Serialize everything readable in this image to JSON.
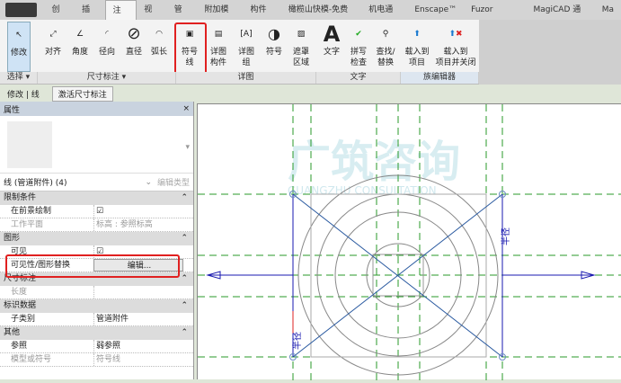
{
  "tabs": [
    "创建",
    "插入",
    "注释",
    "视图",
    "管理",
    "附加模块",
    "构件坞",
    "橄榄山快模-免费版",
    "机电通用",
    "Enscape™",
    "Fuzor Plugin",
    "MagiCAD 通用",
    "Ma"
  ],
  "active_tab": "注释",
  "ribbon": {
    "modify": "修改",
    "select": "选择 ▾",
    "dim": [
      "对齐",
      "角度",
      "径向",
      "直径",
      "弧长"
    ],
    "dim_panel": "尺寸标注 ▾",
    "detail": [
      [
        "符号",
        "线"
      ],
      [
        "详图",
        "构件"
      ],
      [
        "详图",
        "组"
      ],
      [
        "符号",
        ""
      ],
      [
        "遮罩",
        "区域"
      ]
    ],
    "detail_panel": "详图",
    "text": [
      [
        "文字",
        ""
      ],
      [
        "拼写",
        "检查"
      ],
      [
        "查找/",
        "替换"
      ]
    ],
    "text_panel": "文字",
    "family": [
      [
        "载入到",
        "项目"
      ],
      [
        "载入到",
        "项目并关闭"
      ]
    ],
    "family_panel": "族编辑器"
  },
  "options": {
    "context": "修改 | 线",
    "button": "激活尺寸标注"
  },
  "props": {
    "title": "属性",
    "close": "×",
    "type": "线 (管道附件) (4)",
    "edit_type": "编辑类型",
    "sections": [
      {
        "name": "限制条件",
        "rows": [
          [
            "在前景绘制",
            "☑"
          ],
          [
            "工作平面",
            "标高 : 参照标高"
          ]
        ]
      },
      {
        "name": "图形",
        "rows": [
          [
            "可见",
            "☑"
          ],
          [
            "可见性/图形替换",
            "编辑..."
          ]
        ]
      },
      {
        "name": "尺寸标注",
        "rows": [
          [
            "长度",
            ""
          ]
        ]
      },
      {
        "name": "标识数据",
        "rows": [
          [
            "子类别",
            "管道附件"
          ]
        ]
      },
      {
        "name": "其他",
        "rows": [
          [
            "参照",
            "弱参照"
          ],
          [
            "模型或符号",
            "符号线"
          ]
        ]
      }
    ]
  },
  "canvas": {
    "dim_label": "半径",
    "watermark": "广筑咨询",
    "watermark_sub": "GUANGZHU CONSULTATION"
  },
  "colors": {
    "highlight": "#e02020",
    "ref_plane": "#2a9a2a",
    "dim": "#1a1ab0"
  }
}
